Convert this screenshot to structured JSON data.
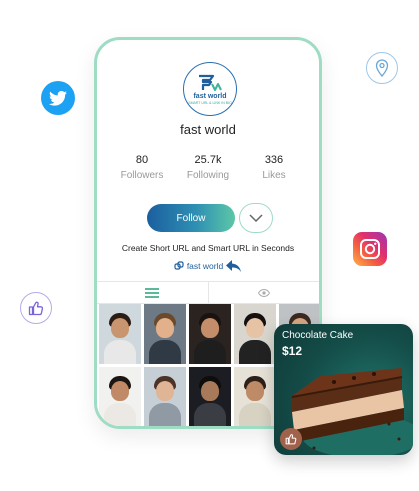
{
  "profile": {
    "name": "fast world",
    "logo_text": "fast world",
    "logo_subtext": "SMART URL & LINK IN BIO",
    "stats": [
      {
        "value": "80",
        "label": "Followers"
      },
      {
        "value": "25.7k",
        "label": "Following"
      },
      {
        "value": "336",
        "label": "Likes"
      }
    ],
    "follow_label": "Follow",
    "bio": "Create Short URL and Smart URL in Seconds",
    "link_label": "fast world"
  },
  "tabs": [
    {
      "name": "list-icon"
    },
    {
      "name": "eye-icon"
    }
  ],
  "product": {
    "title": "Chocolate Cake",
    "price": "$12"
  },
  "colors": {
    "accent_green": "#9fdcc4",
    "brand_blue": "#1f5f9c",
    "twitter": "#1da1f2"
  },
  "photos": [
    {
      "bg": "#cfd8dc",
      "skin": "#c8956e",
      "hair": "#2b1d16",
      "shirt": "#e8e8e8"
    },
    {
      "bg": "#6d7a86",
      "skin": "#e2b08a",
      "hair": "#6b4a2b",
      "shirt": "#2f3a45"
    },
    {
      "bg": "#2a2320",
      "skin": "#c48e6a",
      "hair": "#1a120e",
      "shirt": "#1e1e1e"
    },
    {
      "bg": "#d9d6cf",
      "skin": "#e6c3a5",
      "hair": "#151010",
      "shirt": "#222222"
    },
    {
      "bg": "#bfc2c4",
      "skin": "#d7a683",
      "hair": "#3a2a20",
      "shirt": "#5a4a3e"
    },
    {
      "bg": "#f1f1ef",
      "skin": "#c18a67",
      "hair": "#1d1511",
      "shirt": "#ece9e4"
    },
    {
      "bg": "#c7cfd6",
      "skin": "#dfb596",
      "hair": "#4b3326",
      "shirt": "#8f9aa5"
    },
    {
      "bg": "#1b1d22",
      "skin": "#a97a5a",
      "hair": "#0f0d0c",
      "shirt": "#3a3d44"
    },
    {
      "bg": "#e6e2d8",
      "skin": "#bf8a66",
      "hair": "#2d2019",
      "shirt": "#d8d2c3"
    },
    {
      "bg": "#6f8a5f",
      "skin": "#e0b190",
      "hair": "#6b4a2f",
      "shirt": "#4d6a43"
    }
  ]
}
